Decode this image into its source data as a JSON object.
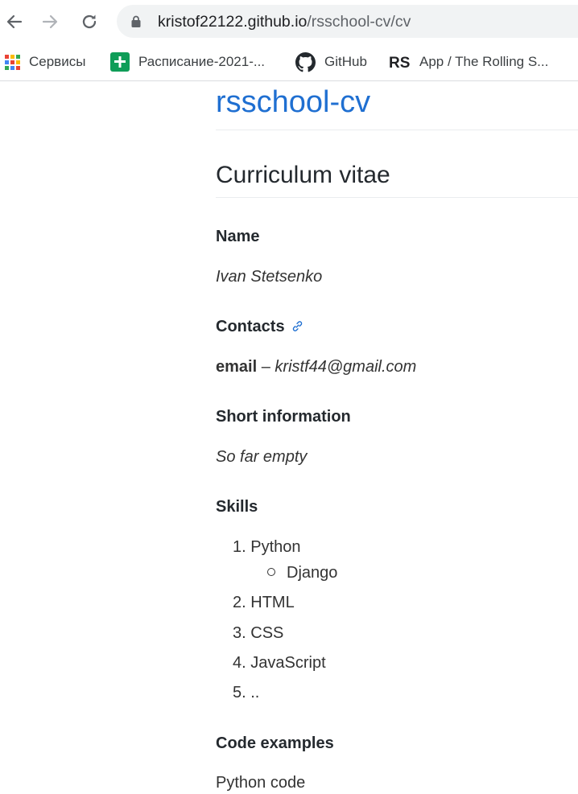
{
  "browser": {
    "url_host": "kristof22122.github.io",
    "url_path": "/rsschool-cv/cv",
    "bookmarks": [
      {
        "label": "Сервисы",
        "icon": "apps-grid-icon"
      },
      {
        "label": "Расписание-2021-...",
        "icon": "google-sheets-icon"
      },
      {
        "label": "GitHub",
        "icon": "github-icon"
      },
      {
        "label": "App / The Rolling S...",
        "icon": "rs-logo-icon"
      }
    ]
  },
  "page": {
    "site_title": "rsschool-cv",
    "heading": "Curriculum vitae",
    "sections": {
      "name": {
        "title": "Name",
        "value": "Ivan Stetsenko"
      },
      "contacts": {
        "title": "Contacts",
        "email_label": "email",
        "separator": " – ",
        "email": "kristf44@gmail.com"
      },
      "short_info": {
        "title": "Short information",
        "value": "So far empty"
      },
      "skills": {
        "title": "Skills",
        "items": [
          {
            "number": "1.",
            "label": "Python",
            "sub": "Django"
          },
          {
            "number": "2.",
            "label": "HTML"
          },
          {
            "number": "3.",
            "label": "CSS"
          },
          {
            "number": "4.",
            "label": "JavaScript"
          },
          {
            "number": "5.",
            "label": ".."
          }
        ]
      },
      "code_examples": {
        "title": "Code examples",
        "partial_text": "Python code"
      }
    }
  },
  "colors": {
    "link": "#1f6fd1",
    "text": "#24292e",
    "rule": "#eaecef"
  }
}
